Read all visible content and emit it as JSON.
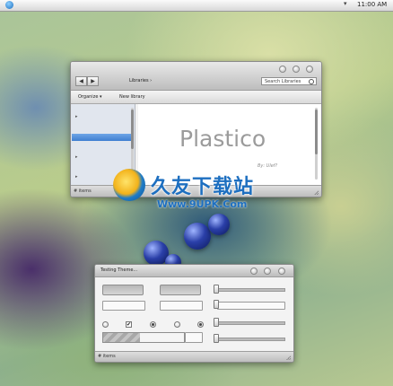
{
  "menubar": {
    "time": "11:00 AM",
    "arrow": "▾"
  },
  "explorer": {
    "breadcrumb": "Libraries ›",
    "search_placeholder": "Search Libraries",
    "back": "◀",
    "forward": "▶",
    "toolbar": {
      "organize": "Organize ▾",
      "new_library": "New library"
    },
    "content_title": "Plastico",
    "byline": "By: Ulef?",
    "status": "# items"
  },
  "testing_window": {
    "title": "Testing Theme...",
    "checkbox_mark": "✔",
    "status": "# items",
    "progress_fraction": 0.45,
    "slider_positions": [
      0.0,
      0.0,
      0.0,
      0.0
    ]
  },
  "watermark": {
    "chinese": "久友下载站",
    "url": "Www.9UPK.Com"
  }
}
